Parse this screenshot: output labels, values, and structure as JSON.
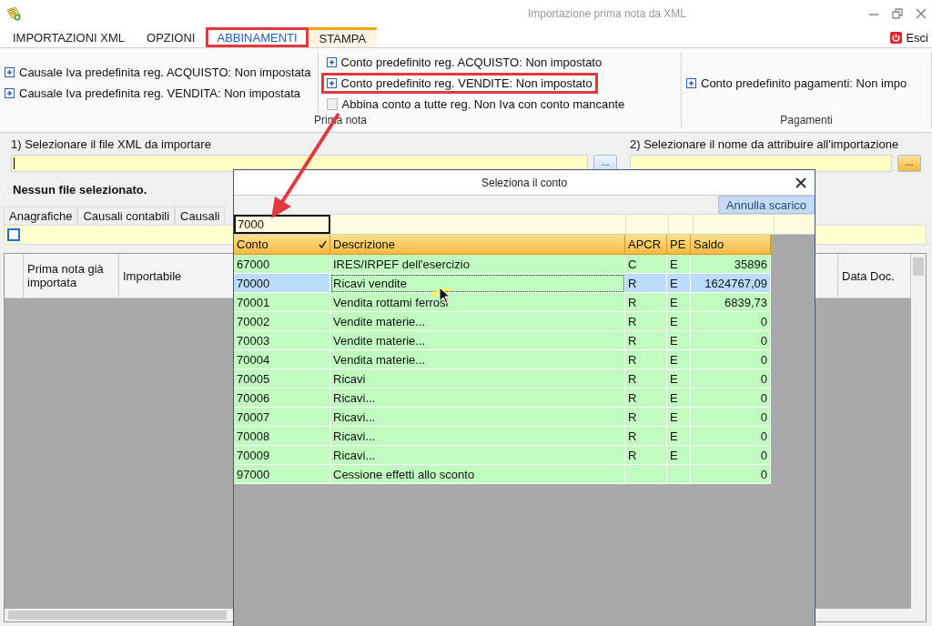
{
  "window": {
    "title": "Importazione prima nota da XML"
  },
  "ribbon_tabs": [
    {
      "label": "IMPORTAZIONI XML",
      "selected": false,
      "hovered": false,
      "highlighted": false
    },
    {
      "label": "OPZIONI",
      "selected": false,
      "hovered": false,
      "highlighted": false
    },
    {
      "label": "ABBINAMENTI",
      "selected": true,
      "hovered": false,
      "highlighted": true
    },
    {
      "label": "STAMPA",
      "selected": false,
      "hovered": true,
      "highlighted": false
    }
  ],
  "exit_button": {
    "label": "Esci"
  },
  "ribbon_groups": [
    {
      "label": "Prima nota",
      "columns": [
        [
          {
            "kind": "expander",
            "label": "Causale Iva predefinita reg. ACQUISTO: Non impostata",
            "highlighted": false
          },
          {
            "kind": "expander",
            "label": "Causale Iva predefinita reg. VENDITA: Non impostata",
            "highlighted": false
          }
        ],
        [
          {
            "kind": "expander",
            "label": "Conto predefinito reg. ACQUISTO: Non impostato",
            "highlighted": false
          },
          {
            "kind": "expander",
            "label": "Conto predefinito reg. VENDITE: Non impostato",
            "highlighted": true
          },
          {
            "kind": "checkbox",
            "label": "Abbina conto a tutte reg. Non Iva con conto mancante",
            "checked": false,
            "highlighted": false
          }
        ]
      ]
    },
    {
      "label": "Pagamenti",
      "columns": [
        [
          {
            "kind": "expander",
            "label": "Conto predefinito pagamenti: Non impo",
            "highlighted": false
          }
        ]
      ]
    }
  ],
  "file_section": {
    "label": "1) Selezionare il file XML da importare",
    "button": "...",
    "status": "Nessun file selezionato."
  },
  "name_section": {
    "label": "2) Selezionare il nome da attribuire all'importazione",
    "button": "..."
  },
  "data_tabs": [
    "Anagrafiche",
    "Causali contabili",
    "Causali"
  ],
  "select_all": {
    "checked": false
  },
  "grid": {
    "columns": [
      "Prima nota già importata",
      "Importabile",
      "Data Doc."
    ]
  },
  "dialog": {
    "title": "Seleziona il conto",
    "toolbar_button": "Annulla scarico",
    "filter": {
      "value": "7000"
    },
    "columns": [
      {
        "label": "Conto",
        "sorted": true
      },
      {
        "label": "Descrizione",
        "sorted": false
      },
      {
        "label": "APCR",
        "sorted": false
      },
      {
        "label": "PE",
        "sorted": false
      },
      {
        "label": "Saldo",
        "sorted": false
      }
    ],
    "rows": [
      {
        "conto": "67000",
        "descrizione": "IRES/IRPEF dell'esercizio",
        "apcr": "C",
        "pe": "E",
        "saldo": "35896",
        "selected": false
      },
      {
        "conto": "70000",
        "descrizione": "Ricavi vendite",
        "apcr": "R",
        "pe": "E",
        "saldo": "1624767,09",
        "selected": true
      },
      {
        "conto": "70001",
        "descrizione": "Vendita rottami ferrosi",
        "apcr": "R",
        "pe": "E",
        "saldo": "6839,73",
        "selected": false
      },
      {
        "conto": "70002",
        "descrizione": "Vendite materie...",
        "apcr": "R",
        "pe": "E",
        "saldo": "0",
        "selected": false
      },
      {
        "conto": "70003",
        "descrizione": "Vendite materie...",
        "apcr": "R",
        "pe": "E",
        "saldo": "0",
        "selected": false
      },
      {
        "conto": "70004",
        "descrizione": "Vendita materie...",
        "apcr": "R",
        "pe": "E",
        "saldo": "0",
        "selected": false
      },
      {
        "conto": "70005",
        "descrizione": "Ricavi",
        "apcr": "R",
        "pe": "E",
        "saldo": "0",
        "selected": false
      },
      {
        "conto": "70006",
        "descrizione": "Ricavi...",
        "apcr": "R",
        "pe": "E",
        "saldo": "0",
        "selected": false
      },
      {
        "conto": "70007",
        "descrizione": "Ricavi...",
        "apcr": "R",
        "pe": "E",
        "saldo": "0",
        "selected": false
      },
      {
        "conto": "70008",
        "descrizione": "Ricavi...",
        "apcr": "R",
        "pe": "E",
        "saldo": "0",
        "selected": false
      },
      {
        "conto": "70009",
        "descrizione": "Ricavi...",
        "apcr": "R",
        "pe": "E",
        "saldo": "0",
        "selected": false
      },
      {
        "conto": "97000",
        "descrizione": "Cessione effetti allo sconto",
        "saldo": "0",
        "selected": false
      }
    ]
  }
}
